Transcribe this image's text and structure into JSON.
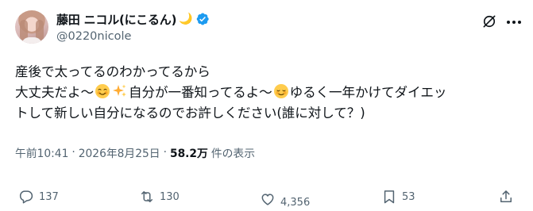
{
  "user": {
    "display_name": "藤田 ニコル(にこるん)",
    "moon_emoji": "🌙",
    "handle": "@0220nicole"
  },
  "tweet": {
    "line1": "産後で太ってるのわかってるから",
    "line2_a": "大丈夫だよ〜",
    "line2_b": "自分が一番知ってるよ〜",
    "line2_c": "ゆるく一年かけてダイエッ",
    "line3": "トして新しい自分になるのでお許しください(誰に対して？)"
  },
  "meta": {
    "time": "午前10:41",
    "separator": "·",
    "date": "2026年8月25日",
    "views_count": "58.2万",
    "views_label": "件の表示"
  },
  "actions": {
    "replies": "137",
    "reposts": "130",
    "likes": "4,356",
    "bookmarks": "53"
  },
  "colors": {
    "text_primary": "#0f1419",
    "text_secondary": "#536471",
    "verified_blue": "#1d9bf0",
    "moon_yellow": "#f2c232"
  },
  "icons": [
    "verified-badge-icon",
    "grok-icon",
    "more-icon",
    "reply-icon",
    "repost-icon",
    "like-icon",
    "bookmark-icon",
    "share-icon",
    "smiling-face-icon",
    "sparkles-icon",
    "relieved-face-icon"
  ]
}
